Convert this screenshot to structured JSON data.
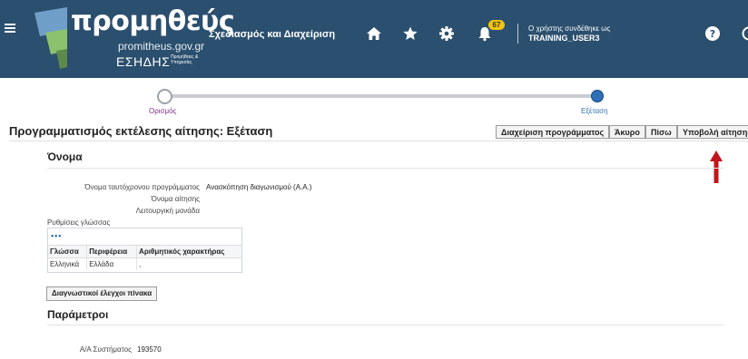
{
  "header": {
    "brand_name": "προμηθεύς",
    "brand_url": "promitheus.gov.gr",
    "brand_sub": "ΕΣΗΔΗΣ",
    "brand_sub_small": "Προμήθειες & Υπηρεσίες",
    "app_title": "Σχεδιασμός και Διαχείριση",
    "notification_count": "67",
    "user_label": "Ο χρήστης συνδέθηκε ως",
    "user_name": "TRAINING_USER3",
    "icons": [
      "menu-icon",
      "home-icon",
      "star-icon",
      "gear-icon",
      "bell-icon",
      "help-icon"
    ],
    "colors": {
      "bar": "#2b4f6e",
      "badge": "#f1c40f"
    }
  },
  "train": {
    "steps": [
      {
        "label": "Ορισμός",
        "state": "visited"
      },
      {
        "label": "Εξέταση",
        "state": "current"
      }
    ]
  },
  "page": {
    "title": "Προγραμματισμός εκτέλεσης αίτησης: Εξέταση",
    "buttons": {
      "manage": "Διαχείριση προγράμματος",
      "cancel": "Άκυρο",
      "back": "Πίσω",
      "submit": "Υποβολή αίτησης"
    }
  },
  "name_section": {
    "heading": "Όνομα",
    "fields": [
      {
        "label": "Όνομα ταυτόχρονου προγράμματος",
        "value": "Ανασκόπηση διαγωνισμού (Α.Α.)"
      },
      {
        "label": "Όνομα αίτησης",
        "value": ""
      },
      {
        "label": "Λειτουργική μονάδα",
        "value": ""
      }
    ],
    "language_settings_label": "Ρυθμίσεις γλώσσας",
    "language_table": {
      "more": "•••",
      "headers": [
        "Γλώσσα",
        "Περιφέρεια",
        "Αριθμητικός χαρακτήρας"
      ],
      "rows": [
        [
          "Ελληνικά",
          "Ελλάδα",
          ","
        ]
      ]
    },
    "diagnostics_button": "Διαγνωστικοί έλεγχοι πίνακα"
  },
  "params_section": {
    "heading": "Παράμετροι",
    "fields": [
      {
        "label": "Α/Α Συστήματος",
        "value": "193570"
      }
    ]
  }
}
